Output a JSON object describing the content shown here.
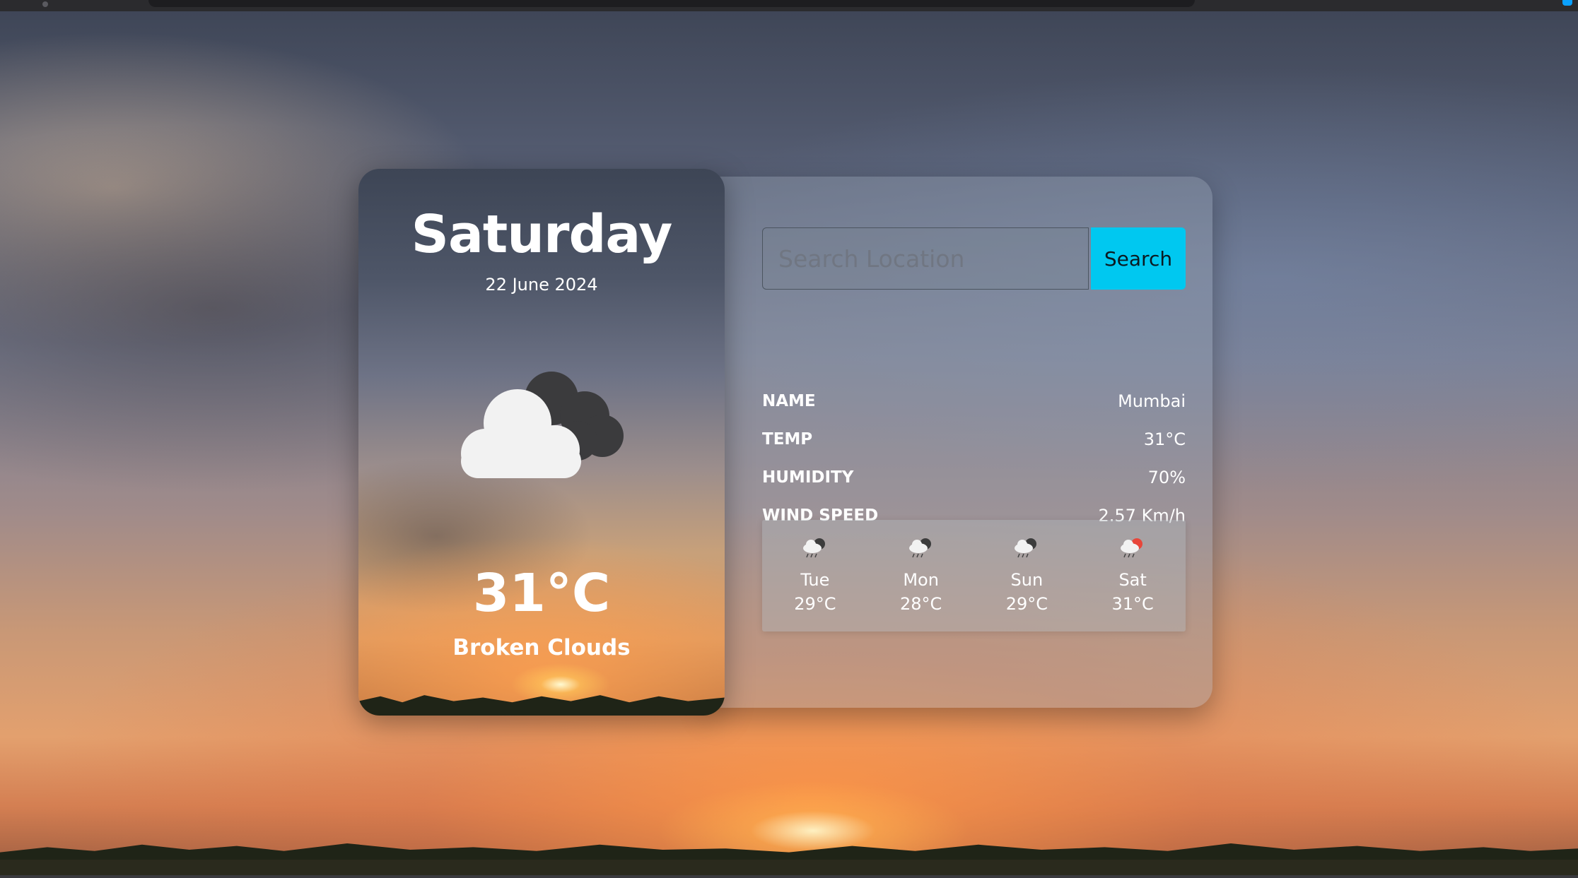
{
  "today": {
    "day": "Saturday",
    "date": "22 June 2024",
    "temperature": "31°C",
    "description": "Broken Clouds",
    "icon": "broken-clouds-icon"
  },
  "search": {
    "placeholder": "Search Location",
    "button_label": "Search"
  },
  "details": [
    {
      "label": "NAME",
      "value": "Mumbai"
    },
    {
      "label": "TEMP",
      "value": "31°C"
    },
    {
      "label": "HUMIDITY",
      "value": "70%"
    },
    {
      "label": "WIND SPEED",
      "value": "2.57 Km/h"
    }
  ],
  "forecast": [
    {
      "day": "Tue",
      "temp": "29°C",
      "icon": "rain-cloud-icon"
    },
    {
      "day": "Mon",
      "temp": "28°C",
      "icon": "rain-cloud-icon"
    },
    {
      "day": "Sun",
      "temp": "29°C",
      "icon": "rain-cloud-icon"
    },
    {
      "day": "Sat",
      "temp": "31°C",
      "icon": "rain-cloud-sun-icon"
    }
  ],
  "colors": {
    "search_button": "#00c8f0",
    "text": "#ffffff"
  }
}
